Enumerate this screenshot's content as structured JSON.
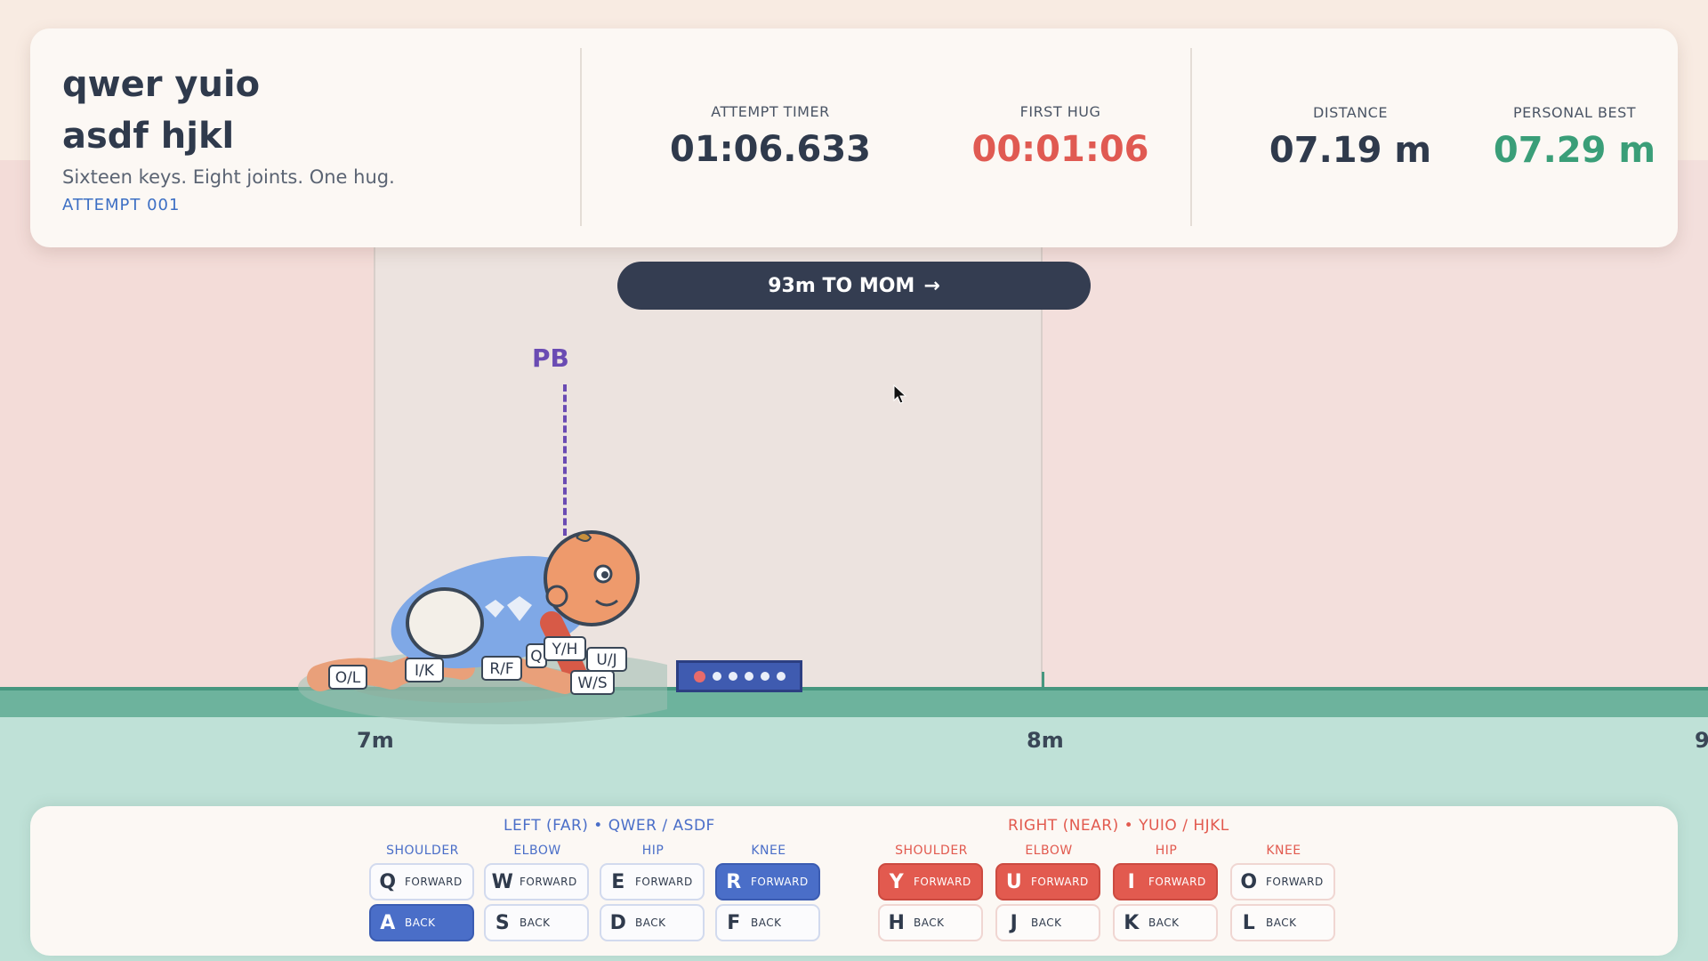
{
  "header": {
    "title_line1": "qwer yuio",
    "title_line2": "asdf hjkl",
    "subtitle": "Sixteen keys. Eight joints. One hug.",
    "attempt": "ATTEMPT  001",
    "stats": [
      {
        "label": "ATTEMPT TIMER",
        "value": "01:06.633",
        "color": "#2f3a4c"
      },
      {
        "label": "FIRST HUG",
        "value": "00:01:06",
        "color": "#e05a52"
      },
      {
        "label": "DISTANCE",
        "value": "07.19 m",
        "color": "#2f3a4c"
      },
      {
        "label": "PERSONAL BEST",
        "value": "07.29 m",
        "color": "#3a9e78"
      }
    ]
  },
  "banner": {
    "text": "93m TO MOM",
    "arrow": "→"
  },
  "track": {
    "pb_label": "PB",
    "ticks": [
      "7m",
      "8m",
      "9"
    ]
  },
  "baby_key_labels": [
    "O/L",
    "I/K",
    "R/F",
    "Q",
    "Y/H",
    "U/J",
    "W/S"
  ],
  "stamina": {
    "dots": 6,
    "active_index": 0
  },
  "controls": {
    "left": {
      "title": "LEFT (FAR)  •  QWER / ASDF",
      "columns": [
        "SHOULDER",
        "ELBOW",
        "HIP",
        "KNEE"
      ],
      "forward": [
        {
          "key": "Q",
          "label": "FORWARD",
          "active": false
        },
        {
          "key": "W",
          "label": "FORWARD",
          "active": false
        },
        {
          "key": "E",
          "label": "FORWARD",
          "active": false
        },
        {
          "key": "R",
          "label": "FORWARD",
          "active": true
        }
      ],
      "back": [
        {
          "key": "A",
          "label": "BACK",
          "active": true
        },
        {
          "key": "S",
          "label": "BACK",
          "active": false
        },
        {
          "key": "D",
          "label": "BACK",
          "active": false
        },
        {
          "key": "F",
          "label": "BACK",
          "active": false
        }
      ]
    },
    "right": {
      "title": "RIGHT (NEAR)  •  YUIO / HJKL",
      "columns": [
        "SHOULDER",
        "ELBOW",
        "HIP",
        "KNEE"
      ],
      "forward": [
        {
          "key": "Y",
          "label": "FORWARD",
          "active": true
        },
        {
          "key": "U",
          "label": "FORWARD",
          "active": true
        },
        {
          "key": "I",
          "label": "FORWARD",
          "active": true
        },
        {
          "key": "O",
          "label": "FORWARD",
          "active": false
        }
      ],
      "back": [
        {
          "key": "H",
          "label": "BACK",
          "active": false
        },
        {
          "key": "J",
          "label": "BACK",
          "active": false
        },
        {
          "key": "K",
          "label": "BACK",
          "active": false
        },
        {
          "key": "L",
          "label": "BACK",
          "active": false
        }
      ]
    }
  },
  "colors": {
    "left_accent": "#4a6ec8",
    "right_accent": "#e25a4f",
    "ground": "#6db39d",
    "pb": "#6a4bb3"
  }
}
